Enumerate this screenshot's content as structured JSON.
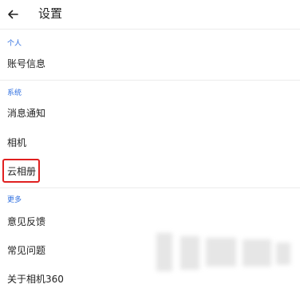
{
  "app_bar": {
    "title": "设置",
    "back_icon": "arrow-left-icon"
  },
  "sections": [
    {
      "header": "个人",
      "items": [
        "账号信息"
      ]
    },
    {
      "header": "系统",
      "items": [
        "消息通知",
        "相机",
        "云相册"
      ]
    },
    {
      "header": "更多",
      "items": [
        "意见反馈",
        "常见问题",
        "关于相机360"
      ]
    }
  ],
  "colors": {
    "section_header": "#2f6fe0",
    "highlight_border": "#e02020",
    "divider": "#ececec"
  }
}
